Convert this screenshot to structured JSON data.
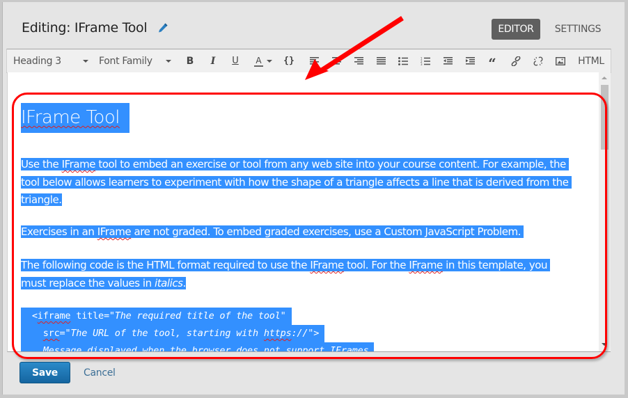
{
  "header": {
    "title": "Editing: IFrame Tool",
    "edit_icon": "pencil-icon",
    "tabs": [
      {
        "label": "EDITOR",
        "active": true
      },
      {
        "label": "SETTINGS",
        "active": false
      }
    ]
  },
  "toolbar": {
    "block_format": "Heading 3",
    "font_family": "Font Family",
    "buttons": [
      {
        "name": "bold",
        "glyph": "B"
      },
      {
        "name": "italic",
        "glyph": "I"
      },
      {
        "name": "underline",
        "glyph": "U"
      },
      {
        "name": "text-color",
        "glyph": "A"
      },
      {
        "name": "code",
        "glyph": "{}"
      },
      {
        "name": "align-left",
        "icon": "align-left-icon"
      },
      {
        "name": "align-center",
        "icon": "align-center-icon"
      },
      {
        "name": "align-right",
        "icon": "align-right-icon"
      },
      {
        "name": "justify",
        "icon": "align-justify-icon"
      },
      {
        "name": "bullet-list",
        "icon": "bullet-list-icon"
      },
      {
        "name": "numbered-list",
        "icon": "numbered-list-icon"
      },
      {
        "name": "outdent",
        "icon": "outdent-icon"
      },
      {
        "name": "indent",
        "icon": "indent-icon"
      },
      {
        "name": "blockquote",
        "glyph": "“"
      },
      {
        "name": "link",
        "icon": "link-icon"
      },
      {
        "name": "unlink",
        "icon": "unlink-icon"
      },
      {
        "name": "image",
        "icon": "image-icon"
      }
    ],
    "html_label": "HTML"
  },
  "content": {
    "heading": "IFrame Tool",
    "p1": {
      "line1_pre": "Use the ",
      "line1_sq": "IFrame",
      "line1_post": " tool to embed an exercise or tool from any web site into your course content. For example, the",
      "line2": "tool below allows learners to experiment with how the shape of a triangle affects a line that is derived from the",
      "line3": "triangle."
    },
    "p2": {
      "pre": "Exercises in an ",
      "sq": "IFrame",
      "post": " are not graded. To embed graded exercises, use a Custom JavaScript Problem."
    },
    "p3": {
      "line1_a": "The following code is the HTML format required to use the ",
      "line1_sq1": "IFrame",
      "line1_b": " tool. For the ",
      "line1_sq2": "IFrame",
      "line1_c": " in this template, you",
      "line2_pre": "must replace the values in ",
      "line2_it": "italics",
      "line2_post": "."
    },
    "code": {
      "l1_lt": "<",
      "l1_sq": "iframe",
      "l1_attr": " title=\"",
      "l1_it": "The required title of the tool",
      "l1_end": "\"",
      "l2_sq": "src",
      "l2_attr": "=\"",
      "l2_it": "The URL of the tool, starting with ",
      "l2_sq2": "https",
      "l2_it2": "://",
      "l2_end": "\">",
      "l3_it": "Message displayed when the browser does not support IFrames"
    }
  },
  "footer": {
    "save_label": "Save",
    "cancel_label": "Cancel"
  },
  "annotation": {
    "color": "#ff0000",
    "type": "arrow-and-rounded-box"
  },
  "colors": {
    "selection": "#3390ff",
    "save_button": "#1f78b8",
    "active_tab": "#5f5f5f"
  }
}
